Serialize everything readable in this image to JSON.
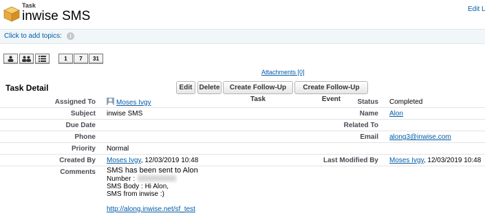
{
  "header": {
    "breadcrumb": "Task",
    "title": "inwise SMS",
    "edit_layout": "Edit La"
  },
  "topics": {
    "label": "Click to add topics:",
    "info_icon": "i"
  },
  "view_buttons": [
    "1",
    "7",
    "31"
  ],
  "attachments": "Attachments [0]",
  "section_title": "Task Detail",
  "actions": {
    "edit": "Edit",
    "delete": "Delete",
    "follow_up_task": "Create Follow-Up Task",
    "follow_up_event": "Create Follow-Up Event"
  },
  "fields": {
    "assigned_to": {
      "label": "Assigned To",
      "value": "Moses Ivgy"
    },
    "subject": {
      "label": "Subject",
      "value": "inwise SMS"
    },
    "due_date": {
      "label": "Due Date",
      "value": ""
    },
    "phone": {
      "label": "Phone",
      "value": ""
    },
    "priority": {
      "label": "Priority",
      "value": "Normal"
    },
    "created_by": {
      "label": "Created By",
      "user": "Moses Ivgy",
      "date": ", 12/03/2019 10:48"
    },
    "comments": {
      "label": "Comments",
      "headline": "SMS has been sent to Alon",
      "number_label": "Number :",
      "body_label": "SMS Body : Hi Alon,",
      "signature": "SMS from inwise :)",
      "link": "http://along.inwise.net/sf_test"
    },
    "status": {
      "label": "Status",
      "value": "Completed"
    },
    "name": {
      "label": "Name",
      "value": "Alon"
    },
    "related_to": {
      "label": "Related To",
      "value": ""
    },
    "email": {
      "label": "Email",
      "value": "along3@inwise.com"
    },
    "last_modified_by": {
      "label": "Last Modified By",
      "user": "Moses Ivgy",
      "date": ", 12/03/2019 10:48"
    }
  },
  "colors": {
    "link": "#015ba7",
    "topics_bar": "#f1f6f9"
  }
}
